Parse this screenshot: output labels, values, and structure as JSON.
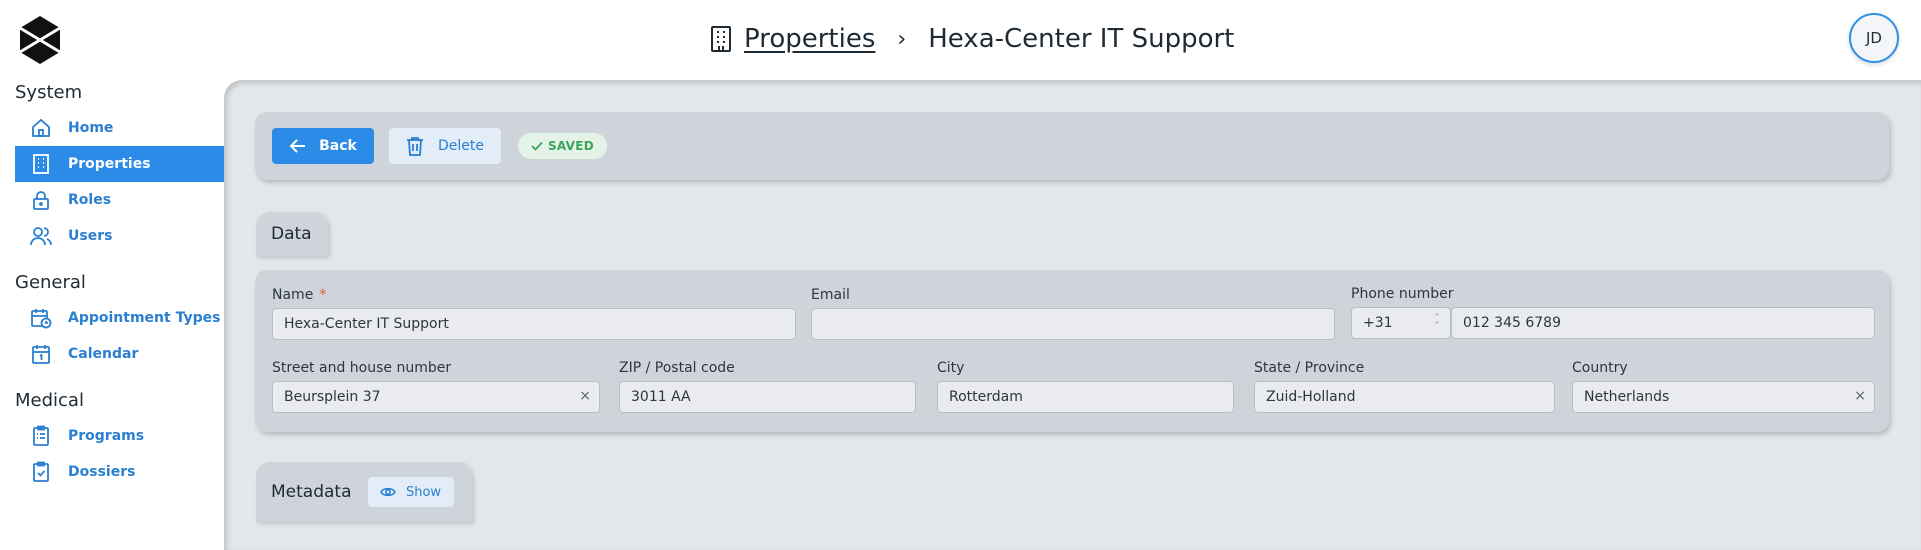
{
  "header": {
    "breadcrumb_parent": "Properties",
    "breadcrumb_separator": "›",
    "breadcrumb_current": "Hexa-Center IT Support",
    "avatar_initials": "JD"
  },
  "sidebar": {
    "sections": [
      {
        "title": "System",
        "items": [
          {
            "label": "Home",
            "icon": "home-icon"
          },
          {
            "label": "Properties",
            "icon": "building-icon",
            "active": true
          },
          {
            "label": "Roles",
            "icon": "lock-icon"
          },
          {
            "label": "Users",
            "icon": "users-icon"
          }
        ]
      },
      {
        "title": "General",
        "items": [
          {
            "label": "Appointment Types",
            "icon": "calendar-clock-icon"
          },
          {
            "label": "Calendar",
            "icon": "calendar-icon"
          }
        ]
      },
      {
        "title": "Medical",
        "items": [
          {
            "label": "Programs",
            "icon": "clipboard-list-icon"
          },
          {
            "label": "Dossiers",
            "icon": "clipboard-check-icon"
          }
        ]
      }
    ]
  },
  "toolbar": {
    "back_label": "Back",
    "delete_label": "Delete",
    "status_label": "SAVED"
  },
  "data_section": {
    "tab_label": "Data",
    "fields": {
      "name": {
        "label": "Name",
        "required_mark": "*",
        "value": "Hexa-Center IT Support"
      },
      "email": {
        "label": "Email",
        "value": ""
      },
      "phone": {
        "label": "Phone number",
        "country_code": "+31",
        "value": "012 345 6789"
      },
      "street": {
        "label": "Street and house number",
        "value": "Beursplein 37",
        "clear": "×"
      },
      "zip": {
        "label": "ZIP / Postal code",
        "value": "3011 AA"
      },
      "city": {
        "label": "City",
        "value": "Rotterdam"
      },
      "state": {
        "label": "State / Province",
        "value": "Zuid-Holland"
      },
      "country": {
        "label": "Country",
        "value": "Netherlands",
        "clear": "×"
      }
    }
  },
  "metadata_section": {
    "tab_label": "Metadata",
    "show_label": "Show"
  },
  "colors": {
    "accent": "#2b8be6",
    "panel": "#cfd4db",
    "background": "#e3e6ea",
    "saved": "#3aa55a"
  }
}
